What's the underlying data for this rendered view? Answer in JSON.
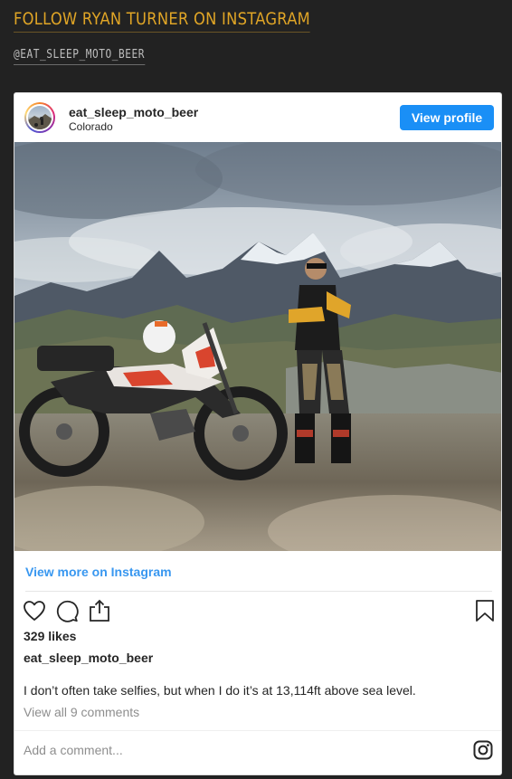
{
  "page": {
    "heading": "FOLLOW RYAN TURNER ON INSTAGRAM",
    "handle": "@EAT_SLEEP_MOTO_BEER"
  },
  "post": {
    "username": "eat_sleep_moto_beer",
    "location": "Colorado",
    "view_profile_label": "View profile",
    "view_more_label": "View more on Instagram",
    "likes": "329 likes",
    "caption_username": "eat_sleep_moto_beer",
    "caption": "I don’t often take selfies, but when I do it’s at 13,114ft above sea level.",
    "comments_link": "View all 9 comments",
    "add_comment_placeholder": "Add a comment..."
  },
  "icons": {
    "like": "heart-icon",
    "comment": "comment-bubble-icon",
    "share": "share-icon",
    "save": "bookmark-icon",
    "brand": "instagram-icon"
  },
  "colors": {
    "page_background": "#222222",
    "heading": "#e0a526",
    "button": "#1a8ff6",
    "link": "#3897f0"
  }
}
